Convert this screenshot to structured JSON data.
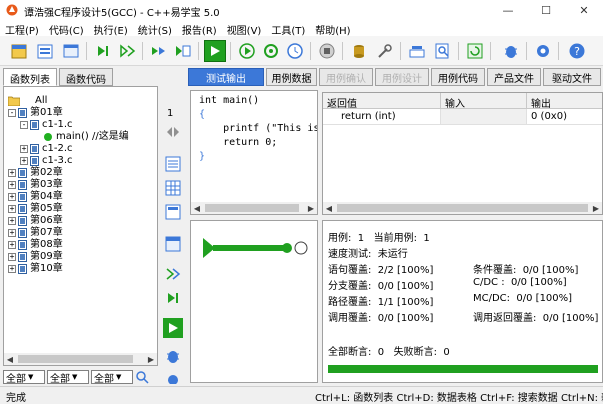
{
  "window": {
    "title": "谭浩强C程序设计5(GCC) - C++易学宝 5.0",
    "minimize": "—",
    "maximize": "☐",
    "close": "✕"
  },
  "menu": [
    {
      "label": "工程(P)"
    },
    {
      "label": "代码(C)"
    },
    {
      "label": "执行(E)"
    },
    {
      "label": "统计(S)"
    },
    {
      "label": "报告(R)"
    },
    {
      "label": "视图(V)"
    },
    {
      "label": "工具(T)"
    },
    {
      "label": "帮助(H)"
    }
  ],
  "toolbar_icons": [
    "new-project-icon",
    "open-project-icon",
    "project-window-icon",
    "step-icon",
    "step-over-icon",
    "run-all-icon",
    "run-case-icon",
    "play-icon",
    "play-circle-icon",
    "reload-icon",
    "clock-icon",
    "stop-icon",
    "database-icon",
    "tool-icon",
    "chart-icon",
    "search-icon",
    "refresh-icon",
    "bug-icon",
    "settings-icon",
    "help-icon"
  ],
  "left_tabs": [
    "函数列表",
    "函数代码"
  ],
  "tree": [
    {
      "label": "All",
      "level": 0,
      "type": "folder"
    },
    {
      "label": "第01章",
      "level": 0,
      "type": "chapter",
      "expander": "-"
    },
    {
      "label": "c1-1.c",
      "level": 1,
      "type": "file",
      "expander": "-"
    },
    {
      "label": "main() //这是编",
      "level": 2,
      "type": "func"
    },
    {
      "label": "c1-2.c",
      "level": 1,
      "type": "file",
      "expander": "+"
    },
    {
      "label": "c1-3.c",
      "level": 1,
      "type": "file",
      "expander": "+"
    },
    {
      "label": "第02章",
      "level": 0,
      "type": "chapter",
      "expander": "+"
    },
    {
      "label": "第03章",
      "level": 0,
      "type": "chapter",
      "expander": "+"
    },
    {
      "label": "第04章",
      "level": 0,
      "type": "chapter",
      "expander": "+"
    },
    {
      "label": "第05章",
      "level": 0,
      "type": "chapter",
      "expander": "+"
    },
    {
      "label": "第06章",
      "level": 0,
      "type": "chapter",
      "expander": "+"
    },
    {
      "label": "第07章",
      "level": 0,
      "type": "chapter",
      "expander": "+"
    },
    {
      "label": "第08章",
      "level": 0,
      "type": "chapter",
      "expander": "+"
    },
    {
      "label": "第09章",
      "level": 0,
      "type": "chapter",
      "expander": "+"
    },
    {
      "label": "第10章",
      "level": 0,
      "type": "chapter",
      "expander": "+"
    }
  ],
  "filters": [
    "全部",
    "全部",
    "全部"
  ],
  "right_tabs": [
    {
      "label": "测试输出",
      "state": "active"
    },
    {
      "label": "用例数据",
      "state": "normal"
    },
    {
      "label": "用例确认",
      "state": "disabled"
    },
    {
      "label": "用例设计",
      "state": "disabled"
    },
    {
      "label": "用例代码",
      "state": "normal"
    },
    {
      "label": "产品文件",
      "state": "normal"
    },
    {
      "label": "驱动文件",
      "state": "normal"
    }
  ],
  "line_number": "1",
  "code": [
    "int main()",
    "{",
    "    printf (\"This is",
    "    return 0;",
    "}"
  ],
  "result_table": {
    "headers": [
      "返回值",
      "输入",
      "输出"
    ],
    "rows": [
      [
        "return (int)",
        "",
        "0 (0x0)"
      ]
    ]
  },
  "stats": {
    "case_line": "用例:  1   当前用例:  1",
    "speed": "速度测试:  未运行",
    "stmt": "语句覆盖:  2/2 [100%]",
    "cond": "条件覆盖:  0/0 [100%]",
    "branch": "分支覆盖:  0/0 [100%]",
    "cdc": "C/DC :  0/0 [100%]",
    "path": "路径覆盖:  1/1 [100%]",
    "mcdc": "MC/DC:  0/0 [100%]",
    "call": "调用覆盖:  0/0 [100%]",
    "callret": "调用返回覆盖:  0/0 [100%]",
    "asserts": "全部断言:  0   失败断言:  0",
    "progress": 1.0
  },
  "status": {
    "left": "完成",
    "right": "Ctrl+L: 函数列表  Ctrl+D: 数据表格  Ctrl+F: 搜索数据  Ctrl+N: 新"
  },
  "colors": {
    "accent": "#3c78d8",
    "success": "#20a020"
  }
}
